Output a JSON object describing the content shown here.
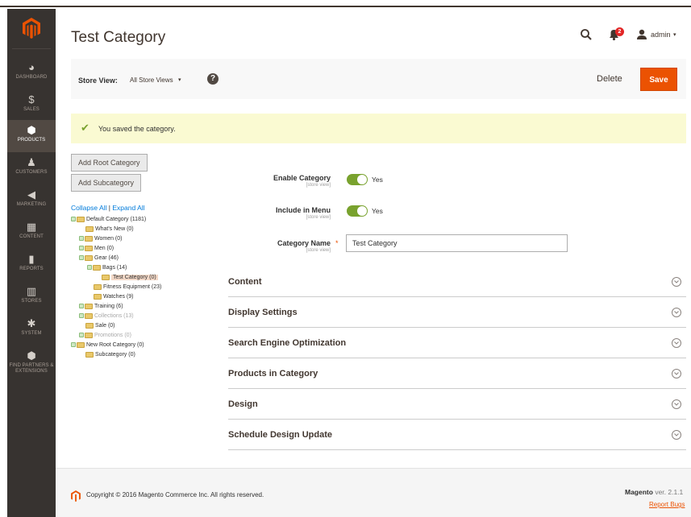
{
  "sidebar": {
    "items": [
      {
        "label": "DASHBOARD",
        "icon": "dashboard-icon",
        "glyph": "◕"
      },
      {
        "label": "SALES",
        "icon": "dollar-icon",
        "glyph": "$"
      },
      {
        "label": "PRODUCTS",
        "icon": "box-icon",
        "glyph": "⬢",
        "active": true
      },
      {
        "label": "CUSTOMERS",
        "icon": "person-icon",
        "glyph": "♟"
      },
      {
        "label": "MARKETING",
        "icon": "megaphone-icon",
        "glyph": "◀"
      },
      {
        "label": "CONTENT",
        "icon": "layout-icon",
        "glyph": "▦"
      },
      {
        "label": "REPORTS",
        "icon": "bar-chart-icon",
        "glyph": "▮"
      },
      {
        "label": "STORES",
        "icon": "storefront-icon",
        "glyph": "▥"
      },
      {
        "label": "SYSTEM",
        "icon": "gear-icon",
        "glyph": "✱"
      },
      {
        "label": "FIND PARTNERS & EXTENSIONS",
        "icon": "cube-icon",
        "glyph": "⬢"
      }
    ]
  },
  "header": {
    "title": "Test Category",
    "notifications_count": "2",
    "user": "admin"
  },
  "actionbar": {
    "store_view_label": "Store View:",
    "store_view_value": "All Store Views",
    "delete_label": "Delete",
    "save_label": "Save"
  },
  "message": {
    "text": "You saved the category."
  },
  "tree_actions": {
    "add_root": "Add Root Category",
    "add_sub": "Add Subcategory",
    "collapse_all": "Collapse All",
    "separator": "|",
    "expand_all": "Expand All"
  },
  "tree": [
    {
      "label": "Default Category (1181)",
      "level": 0,
      "expander": true
    },
    {
      "label": "What's New (0)",
      "level": 1,
      "expander": false
    },
    {
      "label": "Women (0)",
      "level": 1,
      "expander": true
    },
    {
      "label": "Men (0)",
      "level": 1,
      "expander": true
    },
    {
      "label": "Gear (46)",
      "level": 1,
      "expander": true
    },
    {
      "label": "Bags (14)",
      "level": 2,
      "expander": true
    },
    {
      "label": "Test Category (0)",
      "level": 3,
      "expander": false,
      "selected": true
    },
    {
      "label": "Fitness Equipment (23)",
      "level": 2,
      "expander": false
    },
    {
      "label": "Watches (9)",
      "level": 2,
      "expander": false
    },
    {
      "label": "Training (6)",
      "level": 1,
      "expander": true
    },
    {
      "label": "Collections (13)",
      "level": 1,
      "expander": true,
      "muted": true
    },
    {
      "label": "Sale (0)",
      "level": 1,
      "expander": false
    },
    {
      "label": "Promotions (0)",
      "level": 1,
      "expander": true,
      "muted": true
    },
    {
      "label": "New Root Category (0)",
      "level": 0,
      "expander": true
    },
    {
      "label": "Subcategory (0)",
      "level": 1,
      "expander": false
    }
  ],
  "form": {
    "enable_category": {
      "label": "Enable Category",
      "scope": "[store view]",
      "value": "Yes"
    },
    "include_in_menu": {
      "label": "Include in Menu",
      "scope": "[store view]",
      "value": "Yes"
    },
    "category_name": {
      "label": "Category Name",
      "scope": "[store view]",
      "required": "*",
      "value": "Test Category"
    }
  },
  "sections": [
    {
      "title": "Content"
    },
    {
      "title": "Display Settings"
    },
    {
      "title": "Search Engine Optimization"
    },
    {
      "title": "Products in Category"
    },
    {
      "title": "Design"
    },
    {
      "title": "Schedule Design Update"
    }
  ],
  "footer": {
    "copyright": "Copyright © 2016 Magento Commerce Inc. All rights reserved.",
    "brand": "Magento",
    "version": " ver. 2.1.1",
    "report_bugs": "Report Bugs"
  },
  "colors": {
    "accent": "#eb5202",
    "sidebar_bg": "#373330",
    "toggle_on": "#79a22e",
    "message_bg": "#fafad2",
    "link": "#007bdb"
  }
}
